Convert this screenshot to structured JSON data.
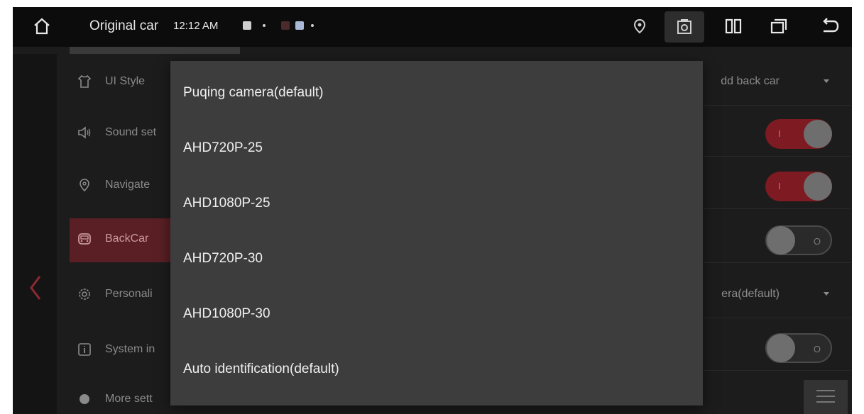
{
  "status_bar": {
    "title": "Original car",
    "time": "12:12 AM",
    "icons": [
      "home-icon",
      "gps-icon",
      "screenshot-icon",
      "split-screen-icon",
      "recent-apps-icon",
      "back-icon"
    ]
  },
  "sidebar": {
    "items": [
      {
        "label": "UI Style",
        "icon": "shirt-icon"
      },
      {
        "label": "Sound set",
        "icon": "speaker-icon"
      },
      {
        "label": "Navigate",
        "icon": "location-pin-icon"
      },
      {
        "label": "BackCar",
        "icon": "car-icon",
        "active": true
      },
      {
        "label": "Personali",
        "icon": "gear-icon"
      },
      {
        "label": "System in",
        "icon": "info-icon"
      },
      {
        "label": "More sett",
        "icon": "more-icon"
      }
    ]
  },
  "settings": {
    "row1_value": "dd back car",
    "row5_value": "era(default)",
    "toggle_on_mark": "I",
    "toggle_off_mark": "O"
  },
  "popup": {
    "options": [
      "Puqing camera(default)",
      "AHD720P-25",
      "AHD1080P-25",
      "AHD720P-30",
      "AHD1080P-30",
      "Auto identification(default)"
    ]
  },
  "colors": {
    "accent": "#7e1a22",
    "popup_bg": "#3d3d3d",
    "statusbar_bg": "#0c0c0c"
  }
}
